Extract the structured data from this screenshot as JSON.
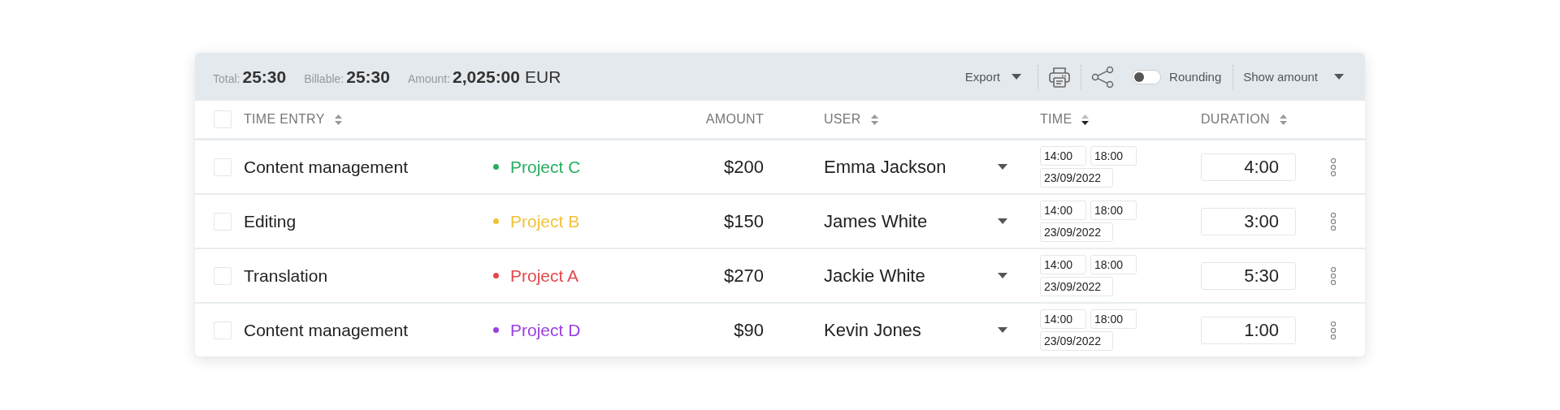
{
  "summary": [
    {
      "label": "Total:",
      "value": "25:30"
    },
    {
      "label": "Billable:",
      "value": "25:30"
    },
    {
      "label": "Amount:",
      "value": "2,025:00",
      "unit": "EUR"
    }
  ],
  "toolbar": {
    "export": "Export",
    "rounding": {
      "label": "Rounding",
      "on": false
    },
    "show_amount": "Show amount"
  },
  "header": {
    "select_all": {
      "checked": false
    },
    "columns": [
      {
        "label": "TIME ENTRY",
        "sorted": false
      },
      {
        "label": "AMOUNT"
      },
      {
        "label": "USER",
        "sorted": false
      },
      {
        "label": "TIME",
        "sorted": true
      },
      {
        "label": "DURATION",
        "sorted": false
      }
    ]
  },
  "rows": [
    {
      "checked": false,
      "description": "Content management",
      "project": "Project C",
      "color": "#27ae60",
      "amount": "$200",
      "user": "Emma Jackson",
      "start": "14:00",
      "end": "18:00",
      "date": "23/09/2022",
      "duration": "4:00"
    },
    {
      "checked": false,
      "description": "Editing",
      "project": "Project B",
      "color": "#f0c23b",
      "amount": "$150",
      "user": "James White",
      "start": "14:00",
      "end": "18:00",
      "date": "23/09/2022",
      "duration": "3:00"
    },
    {
      "checked": false,
      "description": "Translation",
      "project": "Project A",
      "color": "#e5484d",
      "amount": "$270",
      "user": "Jackie White",
      "start": "14:00",
      "end": "18:00",
      "date": "23/09/2022",
      "duration": "5:30"
    },
    {
      "checked": false,
      "description": "Content management",
      "project": "Project D",
      "color": "#9b3fe0",
      "amount": "$90",
      "user": "Kevin Jones",
      "start": "14:00",
      "end": "18:00",
      "date": "23/09/2022",
      "duration": "1:00"
    }
  ]
}
